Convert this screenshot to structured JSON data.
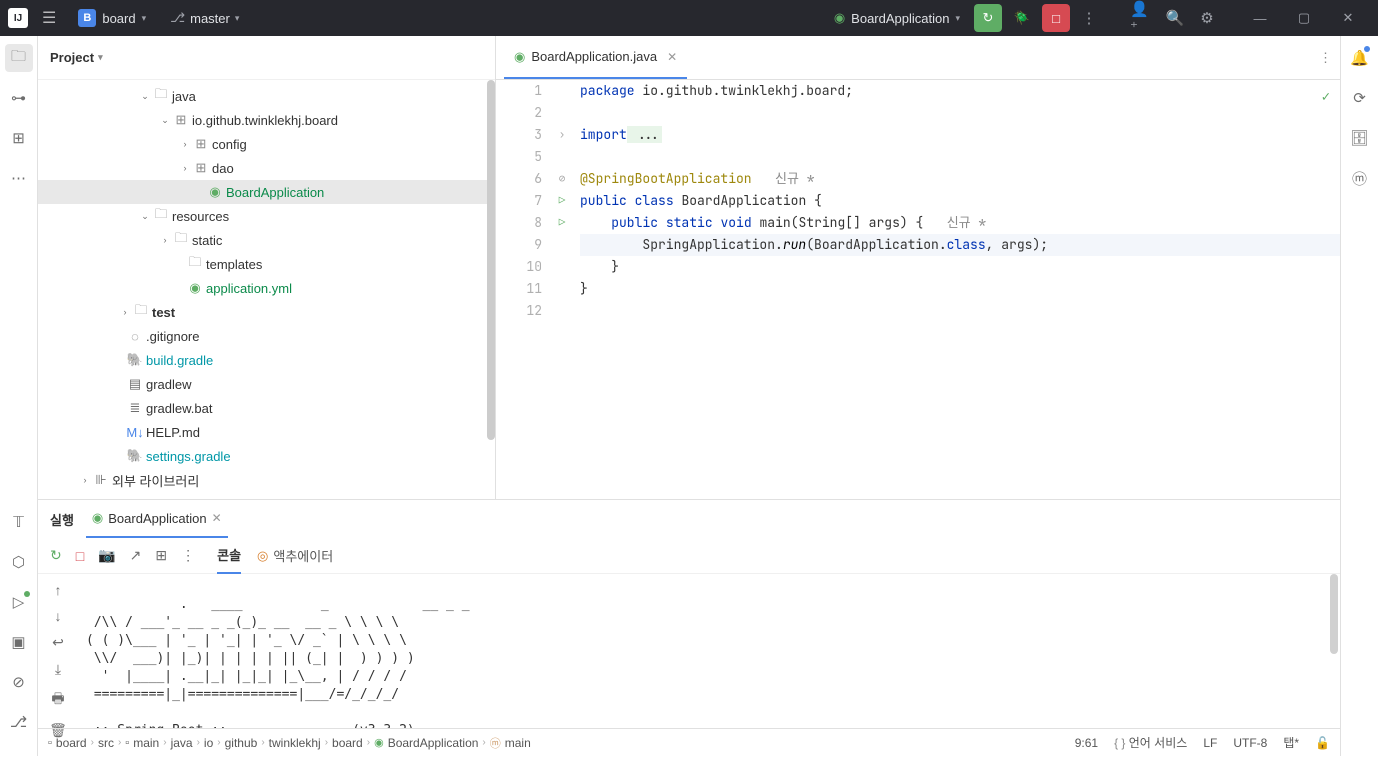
{
  "titlebar": {
    "project_initial": "B",
    "project_name": "board",
    "branch_name": "master",
    "run_config_name": "BoardApplication"
  },
  "project": {
    "panel_title": "Project",
    "tree": {
      "java": "java",
      "pkg": "io.github.twinklekhj.board",
      "config": "config",
      "dao": "dao",
      "boardApp": "BoardApplication",
      "resources": "resources",
      "static": "static",
      "templates": "templates",
      "appYml": "application.yml",
      "test": "test",
      "gitignore": ".gitignore",
      "buildGradle": "build.gradle",
      "gradlew": "gradlew",
      "gradlewBat": "gradlew.bat",
      "helpMd": "HELP.md",
      "settingsGradle": "settings.gradle",
      "extLib": "외부 라이브러리"
    }
  },
  "editor": {
    "tab_name": "BoardApplication.java",
    "lines": [
      "1",
      "2",
      "3",
      "5",
      "6",
      "7",
      "8",
      "9",
      "10",
      "11",
      "12"
    ],
    "inline_hint1": "신규 *",
    "inline_hint2": "신규 *"
  },
  "code": {
    "pkg_kw": "package",
    "pkg_val": " io.github.twinklekhj.board;",
    "import_kw": "import",
    "import_dots": " ...",
    "anno": "@SpringBootApplication",
    "l7": {
      "public": "public",
      "class": "class",
      "name": " BoardApplication {"
    },
    "l8": {
      "public": "public",
      "static": "static",
      "void": "void",
      "main": "main",
      "args": "(String[] args) {"
    },
    "l9": {
      "prefix": "        SpringApplication.",
      "run": "run",
      "mid": "(BoardApplication.",
      "class": "class",
      "suffix": ", args);"
    },
    "l10": "    }",
    "l11": "}"
  },
  "run": {
    "exec_label": "실행",
    "tab_name": "BoardApplication",
    "console_label": "콘솔",
    "actuator_label": "액추에이터"
  },
  "console_output": "  .   ____          _            __ _ _\n /\\\\ / ___'_ __ _ _(_)_ __  __ _ \\ \\ \\ \\\n( ( )\\___ | '_ | '_| | '_ \\/ _` | \\ \\ \\ \\\n \\\\/  ___)| |_)| | | | | || (_| |  ) ) ) )\n  '  |____| .__|_| |_|_| |_\\__, | / / / /\n =========|_|==============|___/=/_/_/_/\n\n :: Spring Boot ::                (v3.3.2)",
  "breadcrumbs": {
    "board": "board",
    "src": "src",
    "main": "main",
    "java": "java",
    "io": "io",
    "github": "github",
    "twinklekhj": "twinklekhj",
    "board2": "board",
    "boardApp": "BoardApplication",
    "mainFn": "main"
  },
  "statusbar": {
    "pos": "9:61",
    "lang_svc": "언어 서비스",
    "line_sep": "LF",
    "encoding": "UTF-8",
    "indent": "탭*"
  }
}
